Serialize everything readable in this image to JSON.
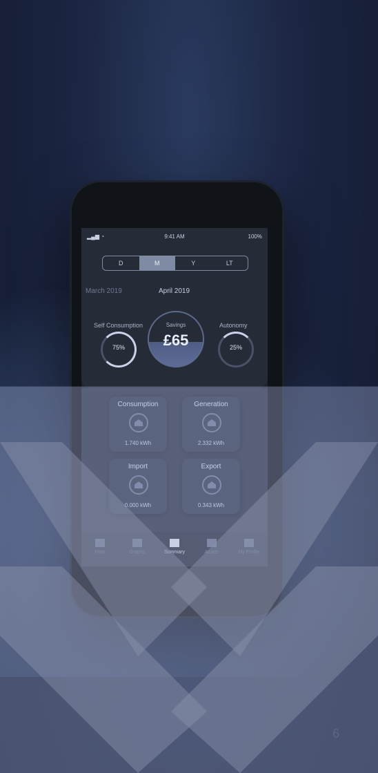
{
  "status": {
    "time": "9:41 AM",
    "battery": "100%"
  },
  "segments": [
    "D",
    "M",
    "Y",
    "LT"
  ],
  "selected_segment": "M",
  "months": {
    "prev": "March 2019",
    "current": "April 2019"
  },
  "self_consumption": {
    "label": "Self Consumption",
    "value": "75%"
  },
  "savings": {
    "label": "Savings",
    "value": "£65"
  },
  "autonomy": {
    "label": "Autonomy",
    "value": "25%"
  },
  "tiles": [
    {
      "title": "Consumption",
      "value": "1.740 kWh",
      "icon": "house-icon"
    },
    {
      "title": "Generation",
      "value": "2.332 kWh",
      "icon": "house-icon"
    },
    {
      "title": "Import",
      "value": "0.000 kWh",
      "icon": "house-icon"
    },
    {
      "title": "Export",
      "value": "0.343 kWh",
      "icon": "house-icon"
    }
  ],
  "nav": [
    "Flow",
    "Graphs",
    "Summary",
    "Assets",
    "My Profile"
  ],
  "selected_nav": "Summary",
  "page_number": "6",
  "colors": {
    "accent": "#7f8aa3",
    "overlay": "#aab6e1"
  }
}
